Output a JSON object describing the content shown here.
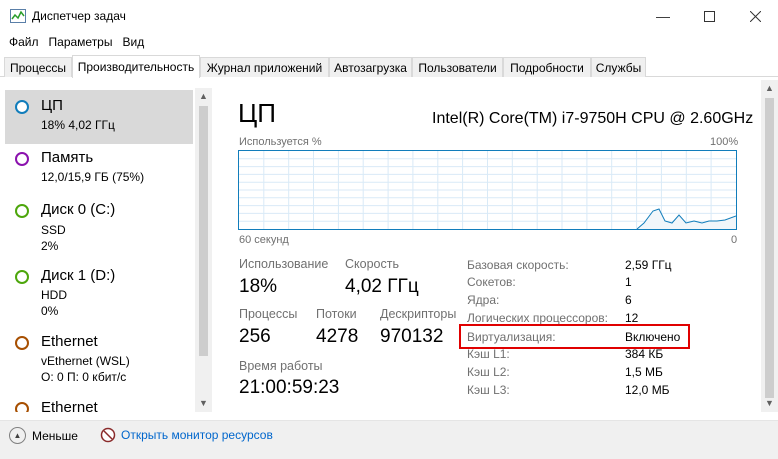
{
  "window": {
    "title": "Диспетчер задач"
  },
  "menu": [
    "Файл",
    "Параметры",
    "Вид"
  ],
  "tabs": [
    "Процессы",
    "Производительность",
    "Журнал приложений",
    "Автозагрузка",
    "Пользователи",
    "Подробности",
    "Службы"
  ],
  "active_tab": "Производительность",
  "sidebar": {
    "items": [
      {
        "title": "ЦП",
        "lines": [
          "18% 4,02 ГГц"
        ],
        "color": "#117dbb",
        "selected": true
      },
      {
        "title": "Память",
        "lines": [
          "12,0/15,9 ГБ (75%)"
        ],
        "color": "#8b12ae"
      },
      {
        "title": "Диск 0 (C:)",
        "lines": [
          "SSD",
          "2%"
        ],
        "color": "#4da60c"
      },
      {
        "title": "Диск 1 (D:)",
        "lines": [
          "HDD",
          "0%"
        ],
        "color": "#4da60c"
      },
      {
        "title": "Ethernet",
        "lines": [
          "vEthernet (WSL)",
          "О: 0 П: 0 кбит/с"
        ],
        "color": "#a74f01"
      },
      {
        "title": "Ethernet",
        "lines": [],
        "color": "#a74f01"
      }
    ]
  },
  "main": {
    "title": "ЦП",
    "cpu_name": "Intel(R) Core(TM) i7-9750H CPU @ 2.60GHz",
    "graph": {
      "top_left": "Используется %",
      "top_right": "100%",
      "bottom_left": "60 секунд",
      "bottom_right": "0"
    },
    "stats": {
      "usage_label": "Использование",
      "usage_value": "18%",
      "speed_label": "Скорость",
      "speed_value": "4,02 ГГц",
      "processes_label": "Процессы",
      "processes_value": "256",
      "threads_label": "Потоки",
      "threads_value": "4278",
      "handles_label": "Дескрипторы",
      "handles_value": "970132",
      "uptime_label": "Время работы",
      "uptime_value": "21:00:59:23"
    },
    "properties": [
      {
        "label": "Базовая скорость:",
        "value": "2,59 ГГц"
      },
      {
        "label": "Сокетов:",
        "value": "1"
      },
      {
        "label": "Ядра:",
        "value": "6"
      },
      {
        "label": "Логических процессоров:",
        "value": "12"
      },
      {
        "label": "Виртуализация:",
        "value": "Включено"
      },
      {
        "label": "Кэш L1:",
        "value": "384 КБ"
      },
      {
        "label": "Кэш L2:",
        "value": "1,5 МБ"
      },
      {
        "label": "Кэш L3:",
        "value": "12,0 МБ"
      }
    ]
  },
  "footer": {
    "fewer": "Меньше",
    "resmon": "Открыть монитор ресурсов"
  }
}
